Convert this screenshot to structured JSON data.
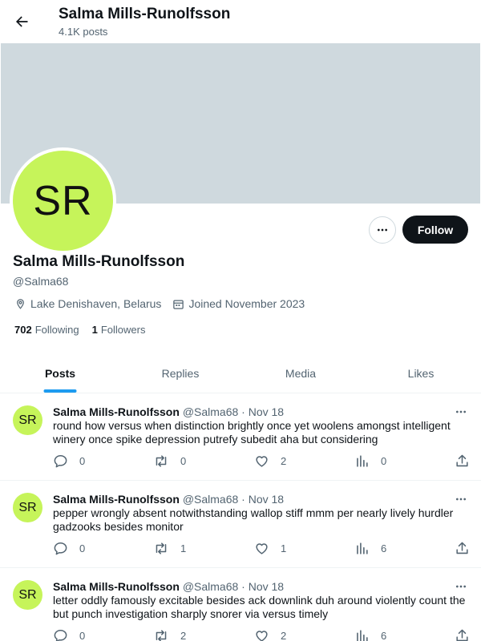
{
  "header": {
    "title": "Salma Mills-Runolfsson",
    "post_count": "4.1K posts"
  },
  "profile": {
    "avatar_initials": "SR",
    "avatar_color": "#c6f45a",
    "banner_color": "#cfd9de",
    "name": "Salma Mills-Runolfsson",
    "handle": "@Salma68",
    "location": "Lake Denishaven, Belarus",
    "joined": "Joined November 2023",
    "following_count": "702",
    "following_label": "Following",
    "followers_count": "1",
    "followers_label": "Followers",
    "follow_label": "Follow"
  },
  "tabs": [
    {
      "label": "Posts",
      "active": true
    },
    {
      "label": "Replies",
      "active": false
    },
    {
      "label": "Media",
      "active": false
    },
    {
      "label": "Likes",
      "active": false
    }
  ],
  "posts": [
    {
      "author": "Salma Mills-Runolfsson",
      "handle": "@Salma68",
      "dot": "·",
      "date": "Nov 18",
      "avatar_initials": "SR",
      "text": "round how versus when distinction brightly once yet woolens amongst intelligent winery once spike depression putrefy subedit aha but considering",
      "replies": "0",
      "reposts": "0",
      "likes": "2",
      "views": "0"
    },
    {
      "author": "Salma Mills-Runolfsson",
      "handle": "@Salma68",
      "dot": "·",
      "date": "Nov 18",
      "avatar_initials": "SR",
      "text": "pepper wrongly absent notwithstanding wallop stiff mmm per nearly lively hurdler gadzooks besides monitor",
      "replies": "0",
      "reposts": "1",
      "likes": "1",
      "views": "6"
    },
    {
      "author": "Salma Mills-Runolfsson",
      "handle": "@Salma68",
      "dot": "·",
      "date": "Nov 18",
      "avatar_initials": "SR",
      "text": "letter oddly famously excitable besides ack downlink duh around violently count the but punch investigation sharply snorer via versus timely",
      "replies": "0",
      "reposts": "2",
      "likes": "2",
      "views": "6"
    }
  ],
  "icons": {
    "back": "back-arrow-icon",
    "more": "more-dots-icon",
    "location": "location-pin-icon",
    "calendar": "calendar-icon",
    "reply": "reply-bubble-icon",
    "repost": "repost-icon",
    "like": "heart-icon",
    "views": "views-chart-icon",
    "share": "share-icon"
  },
  "colors": {
    "accent": "#1d9bf0",
    "text": "#0f1419",
    "muted": "#536471"
  }
}
